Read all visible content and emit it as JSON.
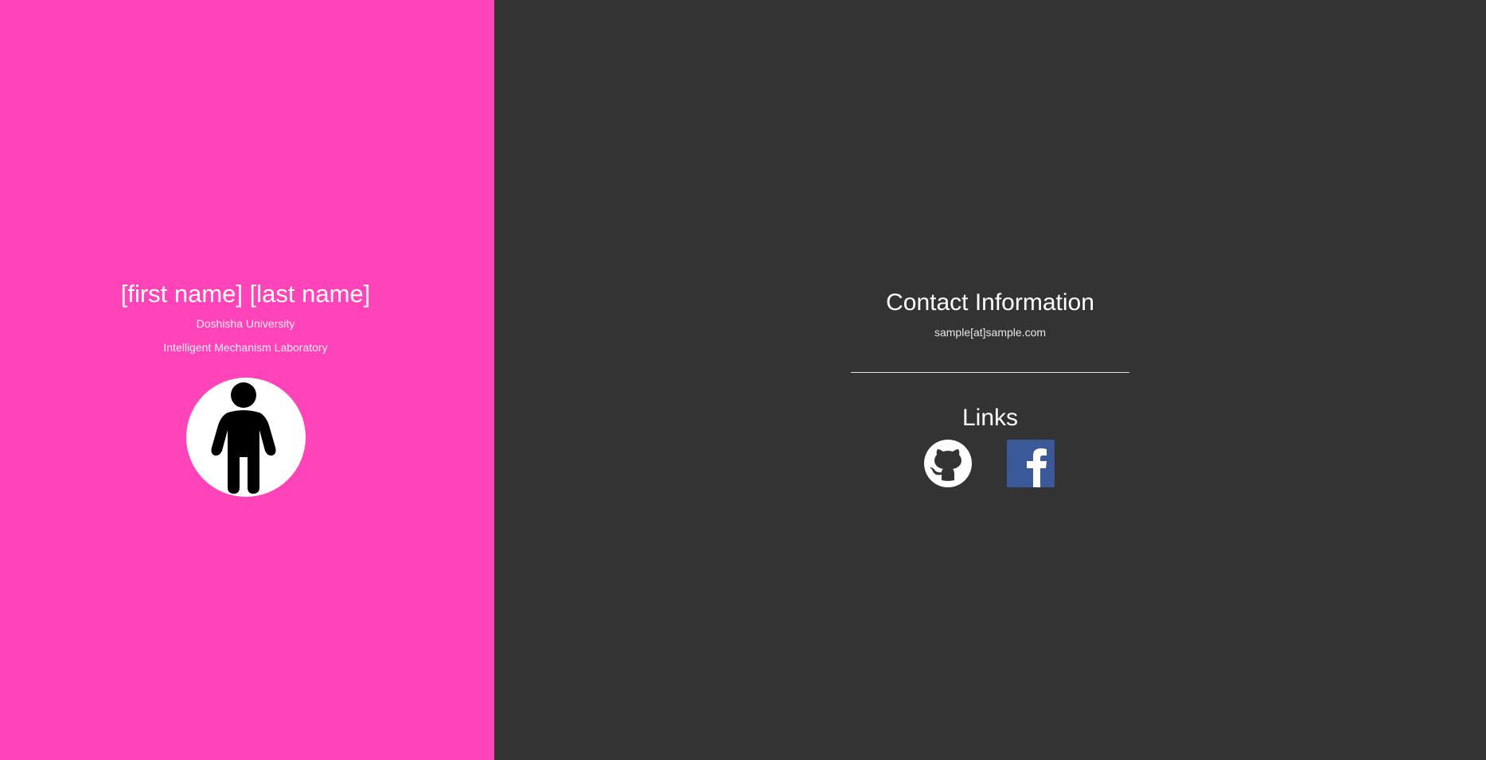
{
  "profile": {
    "name": "[first name] [last name]",
    "university": "Doshisha University",
    "laboratory": "Intelligent Mechanism Laboratory",
    "avatar_icon": "person-icon"
  },
  "contact": {
    "title": "Contact Information",
    "email": "sample[at]sample.com"
  },
  "links": {
    "title": "Links",
    "items": [
      {
        "icon": "github-icon"
      },
      {
        "icon": "facebook-icon"
      }
    ]
  },
  "colors": {
    "left_bg": "#ff44b9",
    "right_bg": "#333333",
    "facebook_blue": "#3b5998"
  }
}
